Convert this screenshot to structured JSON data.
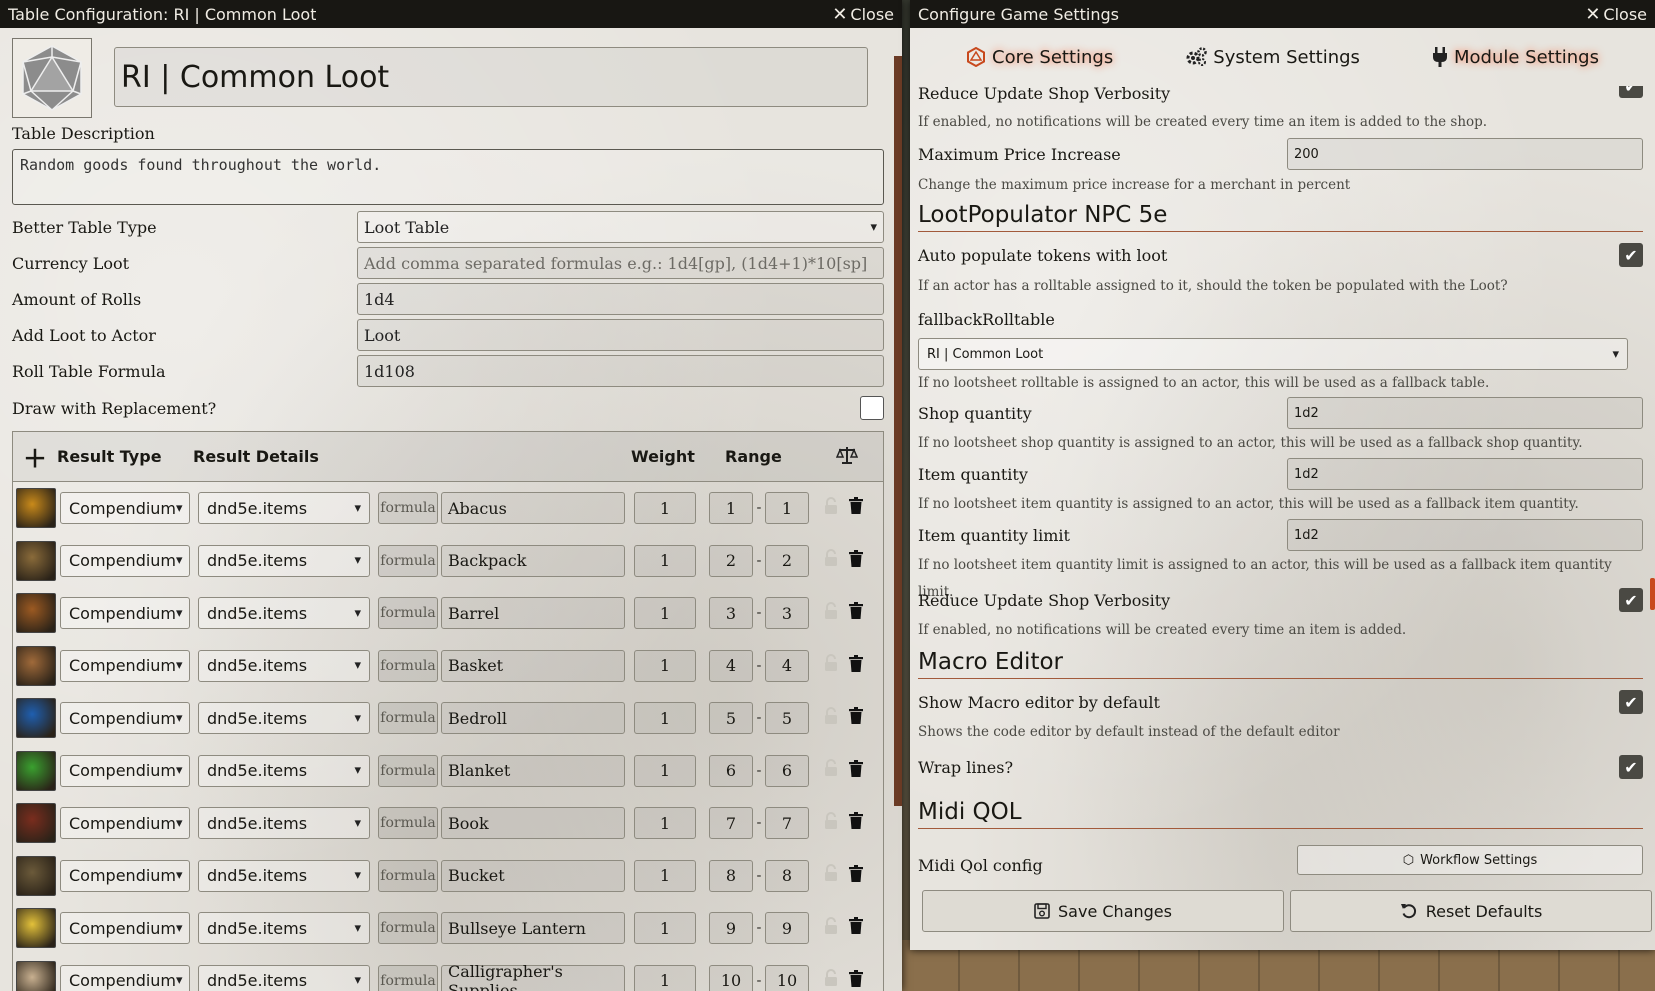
{
  "left_window": {
    "title": "Table Configuration: RI | Common Loot",
    "close_label": "Close",
    "table_name": "RI | Common Loot",
    "description_label": "Table Description",
    "description": "Random goods found throughout the world.",
    "fields": {
      "table_type": {
        "label": "Better Table Type",
        "value": "Loot Table"
      },
      "currency_loot": {
        "label": "Currency Loot",
        "placeholder": "Add comma separated formulas e.g.: 1d4[gp], (1d4+1)*10[sp]"
      },
      "amount_rolls": {
        "label": "Amount of Rolls",
        "value": "1d4"
      },
      "add_loot": {
        "label": "Add Loot to Actor",
        "value": "Loot"
      },
      "roll_formula": {
        "label": "Roll Table Formula",
        "value": "1d108"
      },
      "replacement": {
        "label": "Draw with Replacement?"
      }
    },
    "results_table": {
      "headers": {
        "type": "Result Type",
        "details": "Result Details",
        "weight": "Weight",
        "range": "Range"
      },
      "rows": [
        {
          "type": "Compendium",
          "pack": "dnd5e.items",
          "formula": "formula",
          "name": "Abacus",
          "weight": "1",
          "low": "1",
          "high": "1",
          "color": "#c98a1a"
        },
        {
          "type": "Compendium",
          "pack": "dnd5e.items",
          "formula": "formula",
          "name": "Backpack",
          "weight": "1",
          "low": "2",
          "high": "2",
          "color": "#8a6b3a"
        },
        {
          "type": "Compendium",
          "pack": "dnd5e.items",
          "formula": "formula",
          "name": "Barrel",
          "weight": "1",
          "low": "3",
          "high": "3",
          "color": "#9c5a22"
        },
        {
          "type": "Compendium",
          "pack": "dnd5e.items",
          "formula": "formula",
          "name": "Basket",
          "weight": "1",
          "low": "4",
          "high": "4",
          "color": "#a06a3a"
        },
        {
          "type": "Compendium",
          "pack": "dnd5e.items",
          "formula": "formula",
          "name": "Bedroll",
          "weight": "1",
          "low": "5",
          "high": "5",
          "color": "#1f5fb0"
        },
        {
          "type": "Compendium",
          "pack": "dnd5e.items",
          "formula": "formula",
          "name": "Blanket",
          "weight": "1",
          "low": "6",
          "high": "6",
          "color": "#3aa02f"
        },
        {
          "type": "Compendium",
          "pack": "dnd5e.items",
          "formula": "formula",
          "name": "Book",
          "weight": "1",
          "low": "7",
          "high": "7",
          "color": "#7a2d1e"
        },
        {
          "type": "Compendium",
          "pack": "dnd5e.items",
          "formula": "formula",
          "name": "Bucket",
          "weight": "1",
          "low": "8",
          "high": "8",
          "color": "#6b5a3a"
        },
        {
          "type": "Compendium",
          "pack": "dnd5e.items",
          "formula": "formula",
          "name": "Bullseye Lantern",
          "weight": "1",
          "low": "9",
          "high": "9",
          "color": "#e3c13a"
        },
        {
          "type": "Compendium",
          "pack": "dnd5e.items",
          "formula": "formula",
          "name": "Calligrapher's Supplies",
          "weight": "1",
          "low": "10",
          "high": "10",
          "color": "#c8b090"
        }
      ]
    }
  },
  "right_window": {
    "title": "Configure Game Settings",
    "close_label": "Close",
    "tabs": [
      "Core Settings",
      "System Settings",
      "Module Settings"
    ],
    "settings": {
      "reduce_verbosity_top": {
        "label": "Reduce Update Shop Verbosity",
        "hint": "If enabled, no notifications will be created every time an item is added to the shop.",
        "checked": true
      },
      "max_price": {
        "label": "Maximum Price Increase",
        "value": "200",
        "hint": "Change the maximum price increase for a merchant in percent"
      },
      "section_lootpop": "LootPopulator NPC 5e",
      "auto_populate": {
        "label": "Auto populate tokens with loot",
        "hint": "If an actor has a rolltable assigned to it, should the token be populated with the Loot?",
        "checked": true
      },
      "fallback_table": {
        "label": "fallbackRolltable",
        "value": "RI | Common Loot",
        "hint": "If no lootsheet rolltable is assigned to an actor, this will be used as a fallback table."
      },
      "shop_qty": {
        "label": "Shop quantity",
        "value": "1d2",
        "hint": "If no lootsheet shop quantity is assigned to an actor, this will be used as a fallback shop quantity."
      },
      "item_qty": {
        "label": "Item quantity",
        "value": "1d2",
        "hint": "If no lootsheet item quantity is assigned to an actor, this will be used as a fallback item quantity."
      },
      "item_qty_limit": {
        "label": "Item quantity limit",
        "value": "1d2",
        "hint": "If no lootsheet item quantity limit is assigned to an actor, this will be used as a fallback item quantity limit."
      },
      "reduce_verbosity": {
        "label": "Reduce Update Shop Verbosity",
        "hint": "If enabled, no notifications will be created every time an item is added.",
        "checked": true
      },
      "section_macro": "Macro Editor",
      "show_macro": {
        "label": "Show Macro editor by default",
        "hint": "Shows the code editor by default instead of the default editor",
        "checked": true
      },
      "wrap_lines": {
        "label": "Wrap lines?",
        "checked": true
      },
      "section_midi": "Midi QOL",
      "midi_config": {
        "label": "Midi Qol config",
        "button": "Workflow Settings"
      }
    },
    "footer": {
      "save": "Save Changes",
      "reset": "Reset Defaults"
    }
  },
  "colors": {
    "header_bg": "#181713",
    "accent": "#c8491d",
    "tab_glow": "#ff6a3d",
    "panel": "#e7e4de"
  }
}
